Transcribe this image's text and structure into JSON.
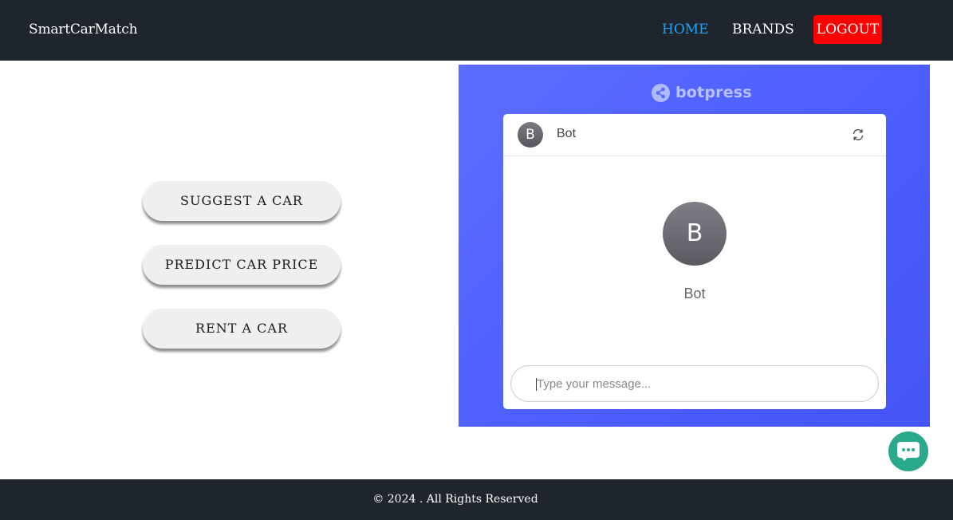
{
  "navbar": {
    "brand": "SmartCarMatch",
    "links": [
      {
        "label": "HOME",
        "active": true
      },
      {
        "label": "BRANDS",
        "active": false
      },
      {
        "label": "LOGOUT",
        "active": false
      }
    ]
  },
  "actions": [
    {
      "label": "SUGGEST A CAR"
    },
    {
      "label": "PREDICT CAR PRICE"
    },
    {
      "label": "RENT A CAR"
    }
  ],
  "chatbot": {
    "logo_text": "botpress",
    "header_avatar_letter": "B",
    "header_name": "Bot",
    "refresh_icon": "refresh-icon",
    "profile_avatar_letter": "B",
    "profile_name": "Bot",
    "input_placeholder": "Type your message..."
  },
  "chat_fab_icon": "chat-bubble-icon",
  "footer": {
    "text": "© 2024 . All Rights Reserved"
  },
  "colors": {
    "navbar_bg": "#1f252d",
    "active_link": "#1aa3ff",
    "logout_bg": "#ff0000",
    "bot_panel": "#4b5dff",
    "chat_fab": "#2aa98b"
  }
}
